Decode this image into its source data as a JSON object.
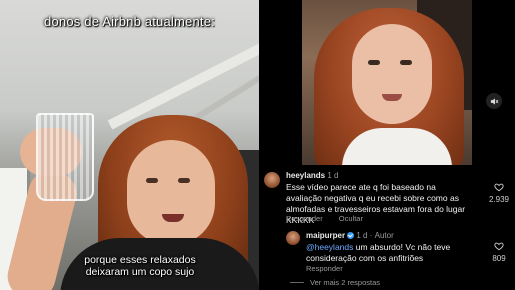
{
  "left_video": {
    "caption_top": "donos de Airbnb atualmente:",
    "caption_bottom_line1": "porque esses relaxados",
    "caption_bottom_line2": "deixaram um copo sujo"
  },
  "right_video": {
    "mute_icon": "speaker-muted-icon"
  },
  "comments": [
    {
      "username": "heeylands",
      "time": "1 d",
      "text": "Esse vídeo parece ate q foi baseado na avaliação negativa q eu recebi sobre como as almofadas e travesseiros estavam fora do lugar KKKKK",
      "reply_label": "Responder",
      "hide_label": "Ocultar",
      "like_count": "2.939"
    },
    {
      "username": "maipurper",
      "time": "1 d",
      "author_label": "Autor",
      "mention": "@heeylands",
      "text": " um absurdo! Vc não teve consideração com os anfitriões",
      "reply_label": "Responder",
      "like_count": "809"
    }
  ],
  "view_more_replies": "Ver mais 2 respostas",
  "colors": {
    "background": "#000000",
    "mention": "#6ea8ff",
    "verified": "#3897f0"
  }
}
